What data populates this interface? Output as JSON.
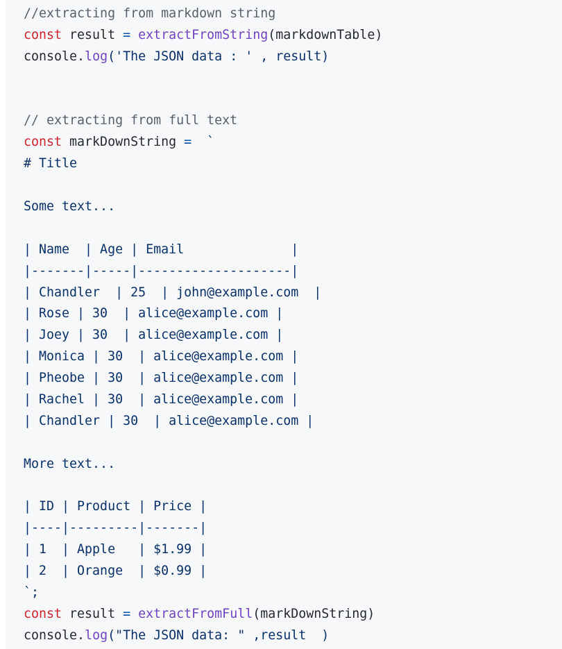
{
  "code_block": {
    "language": "javascript",
    "lines": [
      {
        "type": "comment",
        "text": "//extracting from markdown string"
      },
      {
        "type": "call",
        "keyword": "const",
        "var": " result ",
        "op": "=",
        "fn": " extractFromString",
        "rest": "(markdownTable)"
      },
      {
        "type": "log",
        "obj": "console.",
        "method": "log",
        "rest": "('The JSON data : ' , result)"
      },
      {
        "type": "blank",
        "text": ""
      },
      {
        "type": "blank",
        "text": ""
      },
      {
        "type": "comment",
        "text": "// extracting from full text"
      },
      {
        "type": "assign",
        "keyword": "const",
        "var": " markDownString ",
        "op": "=",
        "rest": "  `"
      },
      {
        "type": "string",
        "text": "# Title"
      },
      {
        "type": "blank",
        "text": ""
      },
      {
        "type": "string",
        "text": "Some text..."
      },
      {
        "type": "blank",
        "text": ""
      },
      {
        "type": "string",
        "text": "| Name  | Age | Email              |"
      },
      {
        "type": "string",
        "text": "|-------|-----|--------------------|"
      },
      {
        "type": "string",
        "text": "| Chandler  | 25  | john@example.com  |"
      },
      {
        "type": "string",
        "text": "| Rose | 30  | alice@example.com |"
      },
      {
        "type": "string",
        "text": "| Joey | 30  | alice@example.com |"
      },
      {
        "type": "string",
        "text": "| Monica | 30  | alice@example.com |"
      },
      {
        "type": "string",
        "text": "| Pheobe | 30  | alice@example.com |"
      },
      {
        "type": "string",
        "text": "| Rachel | 30  | alice@example.com |"
      },
      {
        "type": "string",
        "text": "| Chandler | 30  | alice@example.com |"
      },
      {
        "type": "blank",
        "text": ""
      },
      {
        "type": "string",
        "text": "More text..."
      },
      {
        "type": "blank",
        "text": ""
      },
      {
        "type": "string",
        "text": "| ID | Product | Price |"
      },
      {
        "type": "string",
        "text": "|----|---------|-------|"
      },
      {
        "type": "string",
        "text": "| 1  | Apple   | $1.99 |"
      },
      {
        "type": "string",
        "text": "| 2  | Orange  | $0.99 |"
      },
      {
        "type": "string",
        "text": "`;"
      },
      {
        "type": "call",
        "keyword": "const",
        "var": " result ",
        "op": "=",
        "fn": " extractFromFull",
        "rest": "(markDownString)"
      },
      {
        "type": "log",
        "obj": "console.",
        "method": "log",
        "rest": "(\"The JSON data: \" ,result  )"
      }
    ]
  }
}
